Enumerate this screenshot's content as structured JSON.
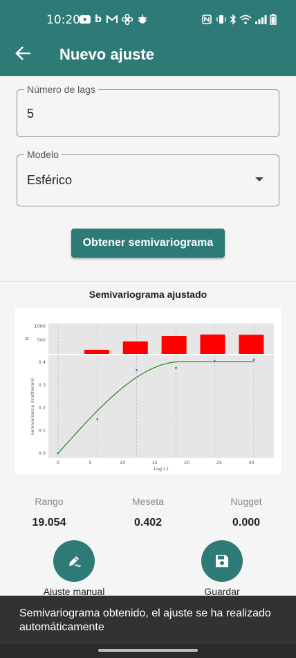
{
  "status_bar": {
    "time": "10:20",
    "left_icons": [
      "youtube-icon",
      "bing-icon",
      "gmail-icon",
      "fan-icon",
      "bug-icon"
    ],
    "right_icons": [
      "nfc-icon",
      "vibrate-icon",
      "bluetooth-icon",
      "wifi-icon",
      "signal-icon",
      "battery-icon"
    ]
  },
  "app_bar": {
    "title": "Nuevo ajuste",
    "back_icon": "arrow-left-icon"
  },
  "form": {
    "lags_label": "Número de lags",
    "lags_value": "5",
    "model_label": "Modelo",
    "model_value": "Esférico",
    "obtain_button": "Obtener semivariograma"
  },
  "chart_section": {
    "title": "Semivariograma ajustado"
  },
  "chart_data": {
    "type": "line",
    "top_panel": {
      "type": "bar",
      "ylabel": "N",
      "yticks": [
        "500",
        "1000"
      ],
      "x": [
        0,
        6,
        12,
        18,
        24,
        30
      ],
      "values": [
        0,
        150,
        450,
        650,
        700,
        690
      ],
      "color": "#ff0000"
    },
    "main_panel": {
      "xlabel": "Lag (-)",
      "ylabel": "semivariance (matheron)",
      "xticks": [
        "0",
        "5",
        "10",
        "15",
        "20",
        "25",
        "30"
      ],
      "yticks": [
        "0.0",
        "0.1",
        "0.2",
        "0.3",
        "0.4"
      ],
      "xlim": [
        -1.5,
        33.5
      ],
      "ylim": [
        -0.02,
        0.43
      ],
      "experimental": {
        "x": [
          0,
          6.1,
          12.2,
          18.3,
          24.3,
          30.4
        ],
        "y": [
          0.0,
          0.15,
          0.365,
          0.375,
          0.405,
          0.41
        ],
        "color": "#3f6fdc"
      },
      "model": {
        "range": 19.054,
        "sill": 0.402,
        "nugget": 0.0,
        "color": "#1a7a1a"
      }
    }
  },
  "results": {
    "range_label": "Rango",
    "range_value": "19.054",
    "sill_label": "Meseta",
    "sill_value": "0.402",
    "nugget_label": "Nugget",
    "nugget_value": "0.000"
  },
  "actions": {
    "manual_label": "Ajuste manual",
    "manual_icon": "edit-pencil-icon",
    "save_label": "Guardar",
    "save_icon": "floppy-disk-icon"
  },
  "snackbar": {
    "message": "Semivariograma obtenido, el ajuste se ha realizado automáticamente"
  },
  "colors": {
    "primary": "#2e7a76",
    "snackbar": "#323232"
  }
}
